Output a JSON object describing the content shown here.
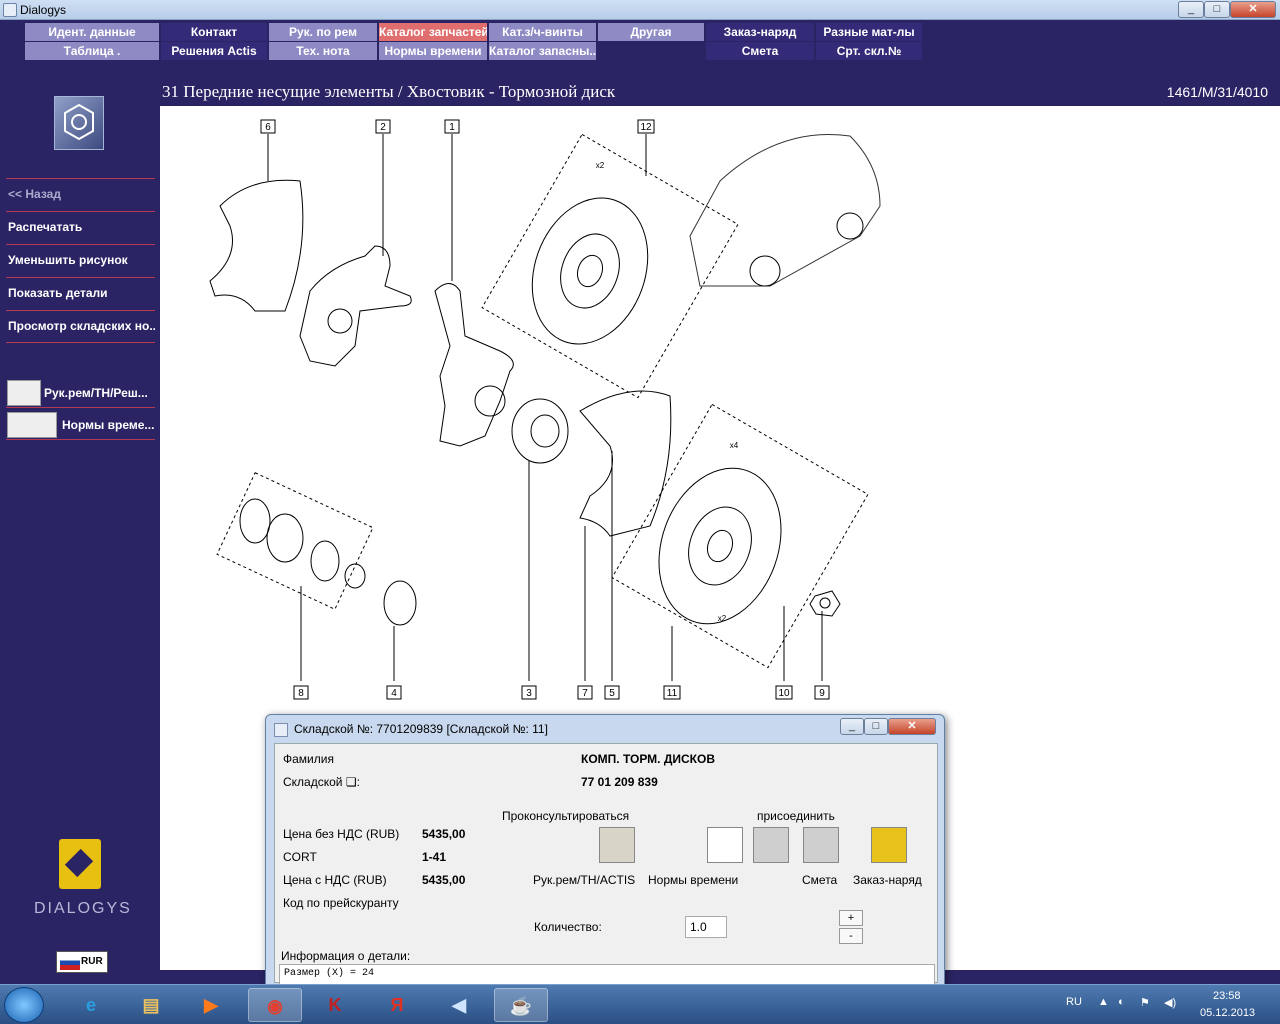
{
  "window": {
    "title": "Dialogys",
    "min": "_",
    "max": "□",
    "close": "✕"
  },
  "menu": {
    "row1": [
      "Идент. данные",
      "Контакт",
      "Рук. по рем",
      "Каталог запчастей",
      "Кат.з/ч-винты",
      "Другая",
      "Заказ-наряд",
      "Разные мат-лы"
    ],
    "row2": [
      "Таблица .",
      "Решения Actis",
      "Тех. нота",
      "Нормы времени",
      "Каталог запасны...",
      "",
      "Смета",
      "Срт. скл.№"
    ]
  },
  "sidebar": {
    "back": "<< Назад",
    "items": [
      "Распечатать",
      "Уменьшить рисунок",
      "Показать детали",
      "Просмотр складских но..."
    ],
    "buttons": [
      "Рук.рем/ТН/Реш...",
      "Нормы време..."
    ],
    "brand": "DIALOGYS",
    "currency": "RUR"
  },
  "header": {
    "title": "31 Передние несущие элементы / Хвостовик - Тормозной диск",
    "ref": "1461/M/31/4010"
  },
  "diagram": {
    "callouts": [
      "6",
      "2",
      "1",
      "12",
      "8",
      "4",
      "3",
      "7",
      "5",
      "11",
      "10",
      "9"
    ],
    "qty_marks": [
      "x2",
      "x4",
      "x2"
    ]
  },
  "dialog": {
    "title": "Складской №: 7701209839 [Складской №: 11]",
    "family_label": "Фамилия",
    "family_value": "КОМП. ТОРМ. ДИСКОВ",
    "part_label": "Складской ❏:",
    "part_value": "77 01 209 839",
    "consult_label": "Проконсультироваться",
    "attach_label": "присоединить",
    "price_net_label": "Цена без НДС (RUB)",
    "price_net_value": "5435,00",
    "cort_label": "CORT",
    "cort_value": "1-41",
    "price_gross_label": "Цена с НДС (RUB)",
    "price_gross_value": "5435,00",
    "pricecode_label": "Код по прейскуранту",
    "tile_labels": [
      "Рук.рем/ТН/ACTIS",
      "Нормы времени",
      "Смета",
      "Заказ-наряд"
    ],
    "qty_label": "Количество:",
    "qty_value": "1.0",
    "plus": "+",
    "minus": "-",
    "info_label": "Информация о детали:",
    "info_text": "Размер (X) = 24"
  },
  "taskbar": {
    "lang": "RU",
    "time": "23:58",
    "date": "05.12.2013"
  }
}
